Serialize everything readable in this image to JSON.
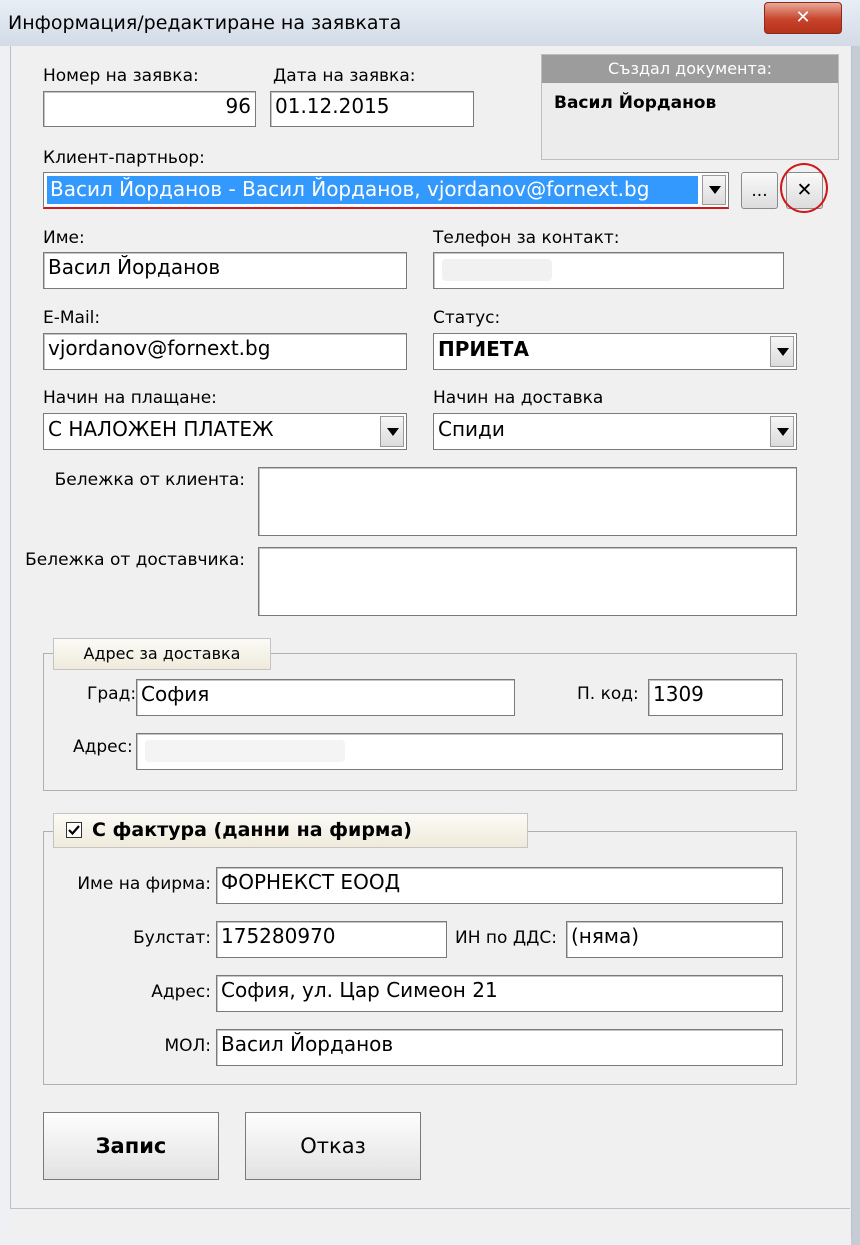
{
  "window": {
    "title": "Информация/редактиране на заявката",
    "close_glyph": "✕"
  },
  "order": {
    "number_label": "Номер на заявка:",
    "number_value": "96",
    "date_label": "Дата на заявка:",
    "date_value": "01.12.2015"
  },
  "creator": {
    "header": "Създал документа:",
    "name": "Васил Йорданов"
  },
  "client": {
    "label": "Клиент-партньор:",
    "selected": "Васил Йорданов -  Васил Йорданов, vjordanov@fornext.bg",
    "browse_label": "...",
    "clear_label": "✕"
  },
  "contact": {
    "name_label": "Име:",
    "name_value": "Васил Йорданов",
    "phone_label": "Телефон за контакт:",
    "email_label": "E-Mail:",
    "email_value": "vjordanov@fornext.bg",
    "status_label": "Статус:",
    "status_value": "ПРИЕТА"
  },
  "payment": {
    "label": "Начин на плащане:",
    "value": "С НАЛОЖЕН ПЛАТЕЖ",
    "delivery_label": "Начин на доставка",
    "delivery_value": "Спиди"
  },
  "notes": {
    "client_label": "Бележка от клиента:",
    "supplier_label": "Бележка от доставчика:"
  },
  "delivery_address": {
    "header": "Адрес за доставка",
    "city_label": "Град:",
    "city_value": "София",
    "postcode_label": "П. код:",
    "postcode_value": "1309",
    "address_label": "Адрес:"
  },
  "invoice": {
    "checkbox_checked": true,
    "header": "С фактура (данни на фирма)",
    "company_label": "Име на фирма:",
    "company_value": "ФОРНЕКСТ ЕООД",
    "bulstat_label": "Булстат:",
    "bulstat_value": "175280970",
    "vat_label": "ИН по ДДС:",
    "vat_value": "(няма)",
    "address_label": "Адрес:",
    "address_value": "София, ул. Цар Симеон 21",
    "mol_label": "МОЛ:",
    "mol_value": "Васил Йорданов"
  },
  "actions": {
    "save_label": "Запис",
    "cancel_label": "Отказ"
  },
  "colors": {
    "selection": "#3399ff",
    "highlight_circle": "#d01818",
    "close_button": "#c7432a"
  }
}
